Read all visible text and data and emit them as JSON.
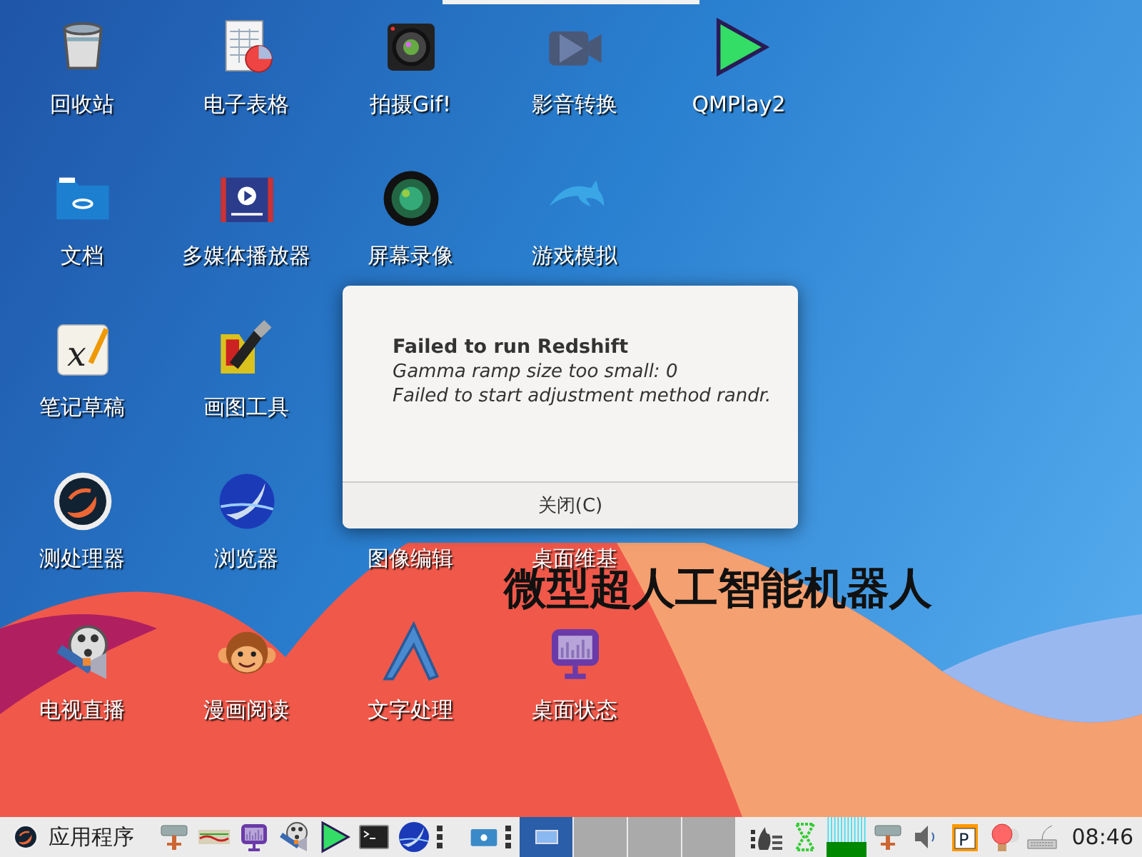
{
  "desktop": {
    "rows": [
      [
        {
          "kind": "trash",
          "label": "回收站"
        },
        {
          "kind": "spreadsheet",
          "label": "电子表格"
        },
        {
          "kind": "camera",
          "label": "拍摄Gif!"
        },
        {
          "kind": "video",
          "label": "影音转换"
        },
        {
          "kind": "play",
          "label": "QMPlay2"
        }
      ],
      [
        {
          "kind": "folder",
          "label": "文档"
        },
        {
          "kind": "film",
          "label": "多媒体播放器"
        },
        {
          "kind": "lens",
          "label": "屏幕录像"
        },
        {
          "kind": "dolphin",
          "label": "游戏模拟"
        }
      ],
      [
        {
          "kind": "pen",
          "label": "笔记草稿",
          "glyph": "x"
        },
        {
          "kind": "paint",
          "label": "画图工具"
        }
      ],
      [
        {
          "kind": "swirl",
          "label": "测处理器"
        },
        {
          "kind": "bird",
          "label": "浏览器"
        },
        {
          "kind": "hidden",
          "label": "图像编辑"
        },
        {
          "kind": "hidden",
          "label": "桌面维基"
        }
      ],
      [
        {
          "kind": "reel",
          "label": "电视直播"
        },
        {
          "kind": "monkey",
          "label": "漫画阅读"
        },
        {
          "kind": "boomerang",
          "label": "文字处理"
        },
        {
          "kind": "monitor",
          "label": "桌面状态"
        }
      ]
    ],
    "wallpaper_text": "微型超人工智能机器人"
  },
  "dialog": {
    "title": "Failed to run Redshift",
    "lines": [
      "Gamma ramp size too small: 0",
      "Failed to start adjustment method randr."
    ],
    "button": "关闭(C)"
  },
  "taskbar": {
    "start_label": "应用程序",
    "launchers": [
      {
        "kind": "network"
      },
      {
        "kind": "ruler"
      },
      {
        "kind": "monitor"
      },
      {
        "kind": "reel"
      },
      {
        "kind": "play"
      },
      {
        "kind": "terminal"
      },
      {
        "kind": "bird"
      }
    ],
    "tasks": [
      {
        "selected": true
      },
      {
        "selected": false
      },
      {
        "selected": false
      },
      {
        "selected": false
      }
    ],
    "tray": [
      {
        "kind": "flame"
      },
      {
        "kind": "hourglass"
      },
      {
        "kind": "graph"
      },
      {
        "kind": "network"
      },
      {
        "kind": "volume"
      },
      {
        "kind": "parking",
        "glyph": "P"
      },
      {
        "kind": "bulb"
      },
      {
        "kind": "keyboard"
      }
    ],
    "clock": "08:46"
  }
}
